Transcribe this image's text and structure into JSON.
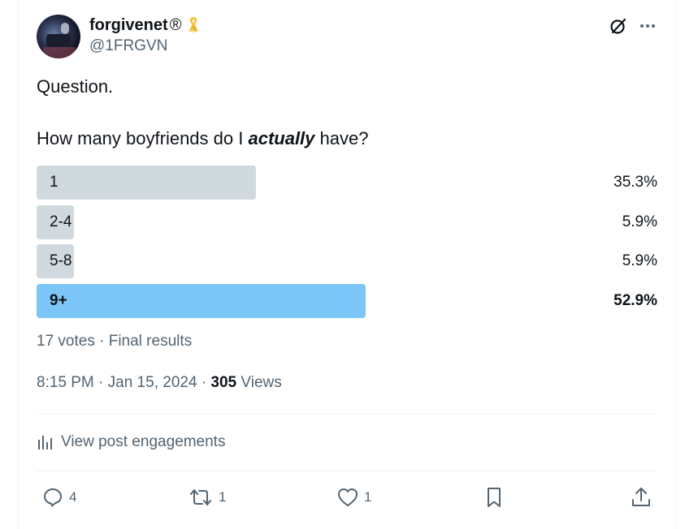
{
  "author": {
    "display_name": "forgivenet",
    "registered_mark": "®",
    "handle": "@1FRGVN"
  },
  "post": {
    "line1": "Question.",
    "line2_before": "How many boyfriends do I ",
    "line2_emph": "actually",
    "line2_after": " have?"
  },
  "poll": {
    "options": [
      {
        "label": "1",
        "percent": "35.3%",
        "fraction": 0.353,
        "winner": false
      },
      {
        "label": "2-4",
        "percent": "5.9%",
        "fraction": 0.059,
        "winner": false
      },
      {
        "label": "5-8",
        "percent": "5.9%",
        "fraction": 0.059,
        "winner": false
      },
      {
        "label": "9+",
        "percent": "52.9%",
        "fraction": 0.529,
        "winner": true
      }
    ],
    "summary": "17 votes · Final results"
  },
  "timestamp": {
    "time_date": "8:15 PM · Jan 15, 2024 · ",
    "views_count": "305",
    "views_label": " Views"
  },
  "engagements_label": "View post engagements",
  "actions": {
    "reply_count": "4",
    "repost_count": "1",
    "like_count": "1"
  },
  "colors": {
    "bar": "#cfd9de",
    "winner_bar": "#7cc5f7",
    "ribbon": "#f4c542"
  },
  "icons": {
    "grok": "grok-icon",
    "more": "more-icon",
    "ribbon": "ribbon-icon",
    "analytics": "analytics-icon",
    "reply": "reply-icon",
    "repost": "repost-icon",
    "like": "like-icon",
    "bookmark": "bookmark-icon",
    "share": "share-icon"
  }
}
